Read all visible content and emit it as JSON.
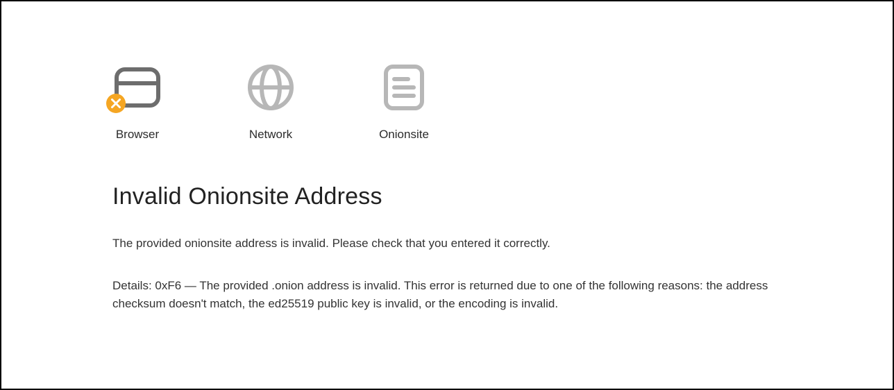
{
  "steps": {
    "browser": {
      "label": "Browser"
    },
    "network": {
      "label": "Network"
    },
    "onionsite": {
      "label": "Onionsite"
    }
  },
  "error": {
    "title": "Invalid Onionsite Address",
    "message": "The provided onionsite address is invalid. Please check that you entered it correctly.",
    "details": "Details: 0xF6 — The provided .onion address is invalid. This error is returned due to one of the following reasons: the address checksum doesn't match, the ed25519 public key is invalid, or the encoding is invalid."
  },
  "colors": {
    "accent_orange": "#f5a623",
    "icon_gray_light": "#b7b7b7",
    "icon_gray_dark": "#6d6d6d"
  }
}
